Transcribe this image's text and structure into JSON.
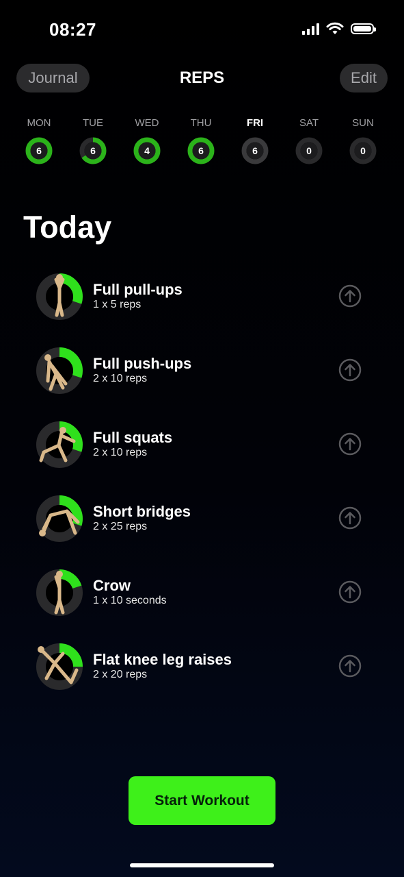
{
  "status_bar": {
    "time": "08:27"
  },
  "header": {
    "journal_label": "Journal",
    "title": "REPS",
    "edit_label": "Edit"
  },
  "week": [
    {
      "label": "MON",
      "count": "6",
      "progress": 1.0,
      "active": false
    },
    {
      "label": "TUE",
      "count": "6",
      "progress": 0.66,
      "active": false
    },
    {
      "label": "WED",
      "count": "4",
      "progress": 1.0,
      "active": false
    },
    {
      "label": "THU",
      "count": "6",
      "progress": 1.0,
      "active": false
    },
    {
      "label": "FRI",
      "count": "6",
      "progress": 0.0,
      "active": true
    },
    {
      "label": "SAT",
      "count": "0",
      "progress": 0.0,
      "active": false
    },
    {
      "label": "SUN",
      "count": "0",
      "progress": 0.0,
      "active": false
    }
  ],
  "section_title": "Today",
  "exercises": [
    {
      "name": "Full pull-ups",
      "detail": "1 x 5 reps",
      "progress": 0.3
    },
    {
      "name": "Full push-ups",
      "detail": "2 x 10 reps",
      "progress": 0.3
    },
    {
      "name": "Full squats",
      "detail": "2 x 10 reps",
      "progress": 0.3
    },
    {
      "name": "Short bridges",
      "detail": "2 x 25 reps",
      "progress": 0.3
    },
    {
      "name": "Crow",
      "detail": "1 x 10 seconds",
      "progress": 0.2
    },
    {
      "name": "Flat knee leg raises",
      "detail": "2 x 20 reps",
      "progress": 0.25
    }
  ],
  "start_button_label": "Start Workout",
  "colors": {
    "accent": "#3ef01a",
    "ring_green": "#2bb31a",
    "ring_track": "#2a2a2c",
    "figure": "#d9b88a"
  }
}
